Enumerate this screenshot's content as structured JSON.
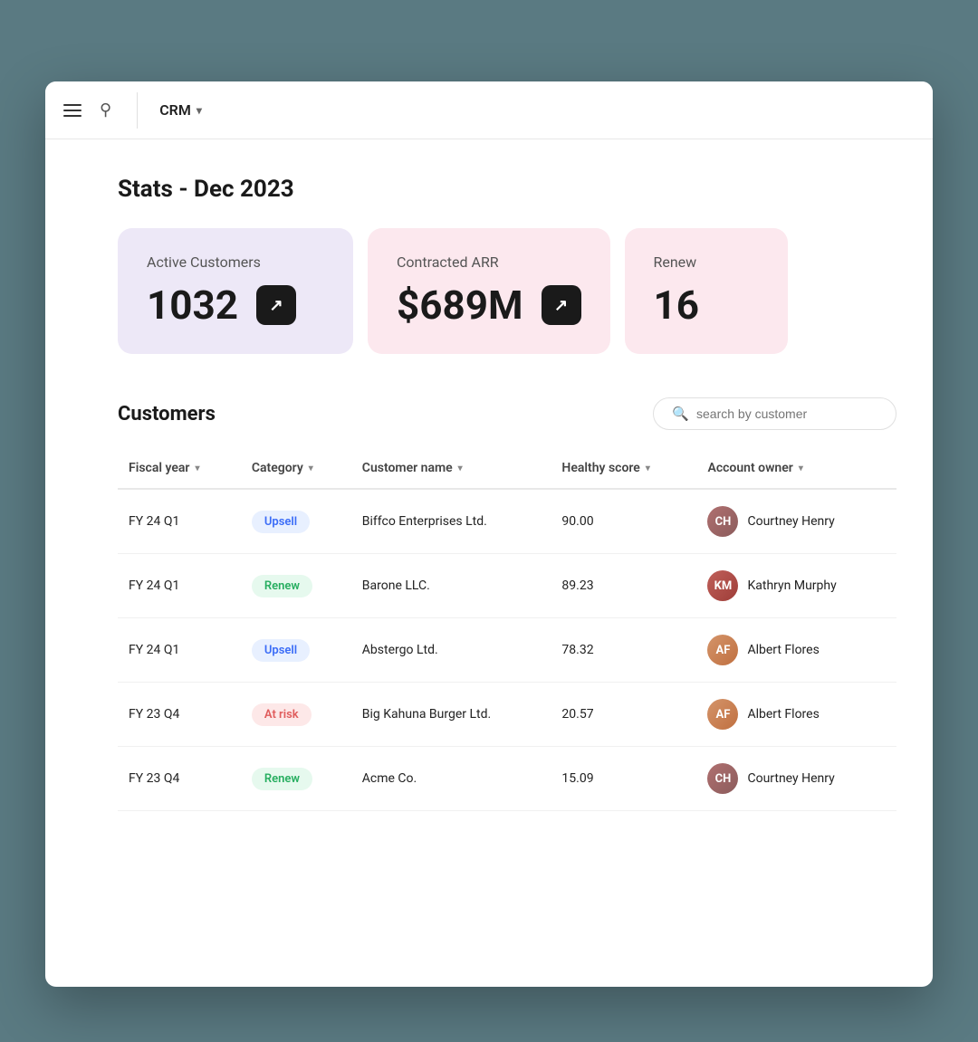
{
  "topbar": {
    "crm_label": "CRM"
  },
  "page": {
    "title": "Stats - Dec 2023"
  },
  "stats": [
    {
      "label": "Active Customers",
      "value": "1032",
      "color": "purple",
      "has_link": true
    },
    {
      "label": "Contracted ARR",
      "value": "$689M",
      "color": "pink",
      "has_link": true
    },
    {
      "label": "Renew",
      "value": "16",
      "color": "pink2",
      "has_link": false,
      "partial": true
    }
  ],
  "customers": {
    "title": "Customers",
    "search_placeholder": "search by customer",
    "columns": [
      {
        "key": "fiscal_year",
        "label": "Fiscal year"
      },
      {
        "key": "category",
        "label": "Category"
      },
      {
        "key": "customer_name",
        "label": "Customer name"
      },
      {
        "key": "healthy_score",
        "label": "Healthy score"
      },
      {
        "key": "account_owner",
        "label": "Account owner"
      }
    ],
    "rows": [
      {
        "fiscal_year": "FY 24 Q1",
        "category": "Upsell",
        "category_type": "upsell",
        "customer_name": "Biffco Enterprises Ltd.",
        "healthy_score": "90.00",
        "account_owner": "Courtney Henry",
        "owner_type": "courtney"
      },
      {
        "fiscal_year": "FY 24 Q1",
        "category": "Renew",
        "category_type": "renew",
        "customer_name": "Barone LLC.",
        "healthy_score": "89.23",
        "account_owner": "Kathryn Murphy",
        "owner_type": "kathryn"
      },
      {
        "fiscal_year": "FY 24 Q1",
        "category": "Upsell",
        "category_type": "upsell",
        "customer_name": "Abstergo Ltd.",
        "healthy_score": "78.32",
        "account_owner": "Albert Flores",
        "owner_type": "albert"
      },
      {
        "fiscal_year": "FY 23 Q4",
        "category": "At risk",
        "category_type": "at-risk",
        "customer_name": "Big Kahuna Burger Ltd.",
        "healthy_score": "20.57",
        "account_owner": "Albert Flores",
        "owner_type": "albert"
      },
      {
        "fiscal_year": "FY 23 Q4",
        "category": "Renew",
        "category_type": "renew",
        "customer_name": "Acme Co.",
        "healthy_score": "15.09",
        "account_owner": "Courtney Henry",
        "owner_type": "courtney"
      }
    ]
  }
}
